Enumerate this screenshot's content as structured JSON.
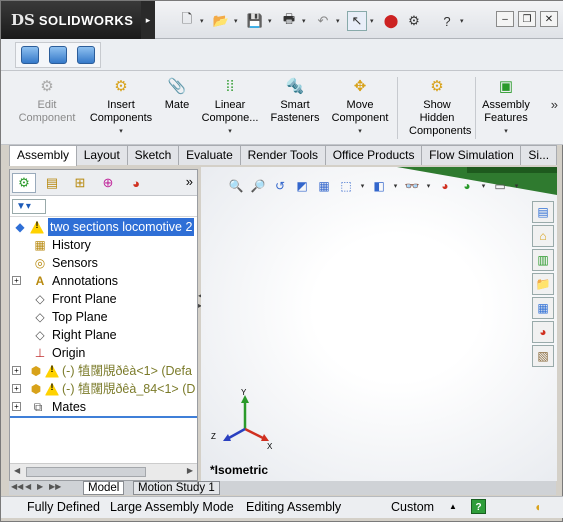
{
  "app": {
    "logo_ds": "DS",
    "logo_name": "SOLIDWORKS"
  },
  "titlebar": {
    "icons": [
      "new-document-icon",
      "open-folder-icon",
      "save-icon",
      "print-icon",
      "undo-icon",
      "select-cursor-icon",
      "traffic-light-icon",
      "options-icon",
      "help-icon"
    ],
    "window_buttons": [
      "minimize",
      "restore",
      "close"
    ]
  },
  "command_manager": {
    "edit_component": "Edit Component",
    "insert_components": "Insert Components",
    "mate": "Mate",
    "linear_component": "Linear Compone...",
    "smart_fasteners": "Smart Fasteners",
    "move_component": "Move Component",
    "show_hidden": "Show Hidden Components",
    "assembly_features": "Assembly Features",
    "more": "»"
  },
  "tabs": [
    {
      "label": "Assembly",
      "active": true
    },
    {
      "label": "Layout"
    },
    {
      "label": "Sketch"
    },
    {
      "label": "Evaluate"
    },
    {
      "label": "Render Tools"
    },
    {
      "label": "Office Products"
    },
    {
      "label": "Flow Simulation"
    },
    {
      "label": "Si..."
    }
  ],
  "feature_manager": {
    "more": "»",
    "tree": {
      "root": "two sections locomotive 2",
      "history": "History",
      "sensors": "Sensors",
      "annotations": "Annotations",
      "front_plane": "Front Plane",
      "top_plane": "Top Plane",
      "right_plane": "Right Plane",
      "origin": "Origin",
      "component1": "(-) 犆闥覑ðêà<1> (Defa",
      "component2": "(-) 犆闥覑ðêà_84<1> (D",
      "mates": "Mates"
    }
  },
  "graphics": {
    "view_label": "*Isometric",
    "triad": {
      "x": "X",
      "y": "Y",
      "z": "Z"
    }
  },
  "bottom_tabs": {
    "model": "Model",
    "motion_study": "Motion Study 1"
  },
  "status": {
    "state": "Fully Defined",
    "mode": "Large Assembly Mode",
    "editing": "Editing Assembly",
    "units": "Custom",
    "help": "?"
  },
  "colors": {
    "selection": "#2f6fd6",
    "logo_bg": "#1a1a1a",
    "model_green": "#2f7a2f"
  }
}
